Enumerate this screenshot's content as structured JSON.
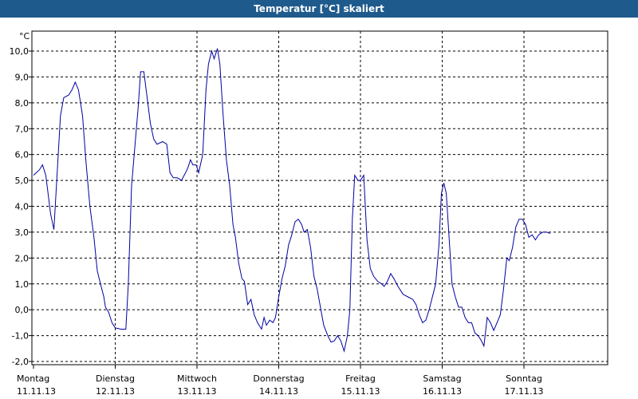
{
  "window": {
    "title": "Temperatur [°C] skaliert"
  },
  "chart_data": {
    "type": "line",
    "title": "Temperatur [°C] skaliert",
    "ylabel": "°C",
    "ylim": [
      -2.0,
      10.0
    ],
    "y_ticks": [
      "10,0",
      "9,0",
      "8,0",
      "7,0",
      "6,0",
      "5,0",
      "4,0",
      "3,0",
      "2,0",
      "1,0",
      "0,0",
      "-1,0",
      "-2,0"
    ],
    "x_range": [
      0,
      7.2
    ],
    "x_ticks": [
      {
        "day": "Montag",
        "date": "11.11.13",
        "x": 0
      },
      {
        "day": "Dienstag",
        "date": "12.11.13",
        "x": 1
      },
      {
        "day": "Mittwoch",
        "date": "13.11.13",
        "x": 2
      },
      {
        "day": "Donnerstag",
        "date": "14.11.13",
        "x": 3
      },
      {
        "day": "Freitag",
        "date": "15.11.13",
        "x": 4
      },
      {
        "day": "Samstag",
        "date": "16.11.13",
        "x": 5
      },
      {
        "day": "Sonntag",
        "date": "17.11.13",
        "x": 6
      }
    ],
    "grid": true,
    "line_color": "#0000a0",
    "series": [
      {
        "values": [
          [
            0.0,
            5.2
          ],
          [
            0.07,
            5.4
          ],
          [
            0.11,
            5.6
          ],
          [
            0.15,
            5.2
          ],
          [
            0.21,
            3.7
          ],
          [
            0.25,
            3.1
          ],
          [
            0.29,
            5.3
          ],
          [
            0.33,
            7.5
          ],
          [
            0.37,
            8.2
          ],
          [
            0.43,
            8.3
          ],
          [
            0.47,
            8.5
          ],
          [
            0.51,
            8.8
          ],
          [
            0.55,
            8.5
          ],
          [
            0.6,
            7.5
          ],
          [
            0.64,
            5.8
          ],
          [
            0.69,
            4.0
          ],
          [
            0.74,
            2.8
          ],
          [
            0.78,
            1.5
          ],
          [
            0.82,
            1.0
          ],
          [
            0.86,
            0.5
          ],
          [
            0.88,
            0.1
          ],
          [
            0.92,
            -0.1
          ],
          [
            0.96,
            -0.5
          ],
          [
            1.0,
            -0.7
          ],
          [
            1.07,
            -0.75
          ],
          [
            1.13,
            -0.75
          ],
          [
            1.16,
            1.0
          ],
          [
            1.2,
            4.8
          ],
          [
            1.24,
            6.3
          ],
          [
            1.28,
            7.8
          ],
          [
            1.31,
            9.2
          ],
          [
            1.35,
            9.2
          ],
          [
            1.39,
            8.2
          ],
          [
            1.43,
            7.2
          ],
          [
            1.47,
            6.6
          ],
          [
            1.51,
            6.4
          ],
          [
            1.58,
            6.5
          ],
          [
            1.63,
            6.4
          ],
          [
            1.67,
            5.3
          ],
          [
            1.71,
            5.1
          ],
          [
            1.76,
            5.1
          ],
          [
            1.81,
            5.0
          ],
          [
            1.86,
            5.3
          ],
          [
            1.89,
            5.5
          ],
          [
            1.92,
            5.8
          ],
          [
            1.95,
            5.6
          ],
          [
            1.99,
            5.6
          ],
          [
            2.02,
            5.3
          ],
          [
            2.07,
            6.0
          ],
          [
            2.11,
            8.5
          ],
          [
            2.14,
            9.5
          ],
          [
            2.18,
            10.0
          ],
          [
            2.21,
            9.7
          ],
          [
            2.25,
            10.1
          ],
          [
            2.28,
            9.5
          ],
          [
            2.32,
            7.5
          ],
          [
            2.36,
            5.8
          ],
          [
            2.4,
            4.8
          ],
          [
            2.44,
            3.3
          ],
          [
            2.47,
            2.8
          ],
          [
            2.51,
            1.8
          ],
          [
            2.55,
            1.2
          ],
          [
            2.58,
            1.1
          ],
          [
            2.62,
            0.2
          ],
          [
            2.66,
            0.4
          ],
          [
            2.7,
            -0.2
          ],
          [
            2.74,
            -0.5
          ],
          [
            2.79,
            -0.75
          ],
          [
            2.82,
            -0.3
          ],
          [
            2.85,
            -0.6
          ],
          [
            2.89,
            -0.4
          ],
          [
            2.93,
            -0.5
          ],
          [
            2.96,
            -0.3
          ],
          [
            3.0,
            0.5
          ],
          [
            3.04,
            1.2
          ],
          [
            3.08,
            1.7
          ],
          [
            3.12,
            2.5
          ],
          [
            3.16,
            2.9
          ],
          [
            3.2,
            3.4
          ],
          [
            3.24,
            3.5
          ],
          [
            3.28,
            3.3
          ],
          [
            3.31,
            3.0
          ],
          [
            3.35,
            3.1
          ],
          [
            3.39,
            2.4
          ],
          [
            3.43,
            1.3
          ],
          [
            3.47,
            0.8
          ],
          [
            3.51,
            0.1
          ],
          [
            3.55,
            -0.6
          ],
          [
            3.6,
            -1.0
          ],
          [
            3.64,
            -1.25
          ],
          [
            3.68,
            -1.2
          ],
          [
            3.72,
            -1.0
          ],
          [
            3.76,
            -1.2
          ],
          [
            3.8,
            -1.6
          ],
          [
            3.84,
            -1.0
          ],
          [
            3.87,
            0.0
          ],
          [
            3.9,
            3.5
          ],
          [
            3.93,
            5.2
          ],
          [
            3.97,
            5.0
          ],
          [
            4.0,
            5.0
          ],
          [
            4.04,
            5.2
          ],
          [
            4.08,
            2.7
          ],
          [
            4.12,
            1.6
          ],
          [
            4.16,
            1.3
          ],
          [
            4.21,
            1.1
          ],
          [
            4.26,
            1.0
          ],
          [
            4.29,
            0.9
          ],
          [
            4.33,
            1.1
          ],
          [
            4.37,
            1.4
          ],
          [
            4.41,
            1.2
          ],
          [
            4.46,
            0.9
          ],
          [
            4.52,
            0.6
          ],
          [
            4.58,
            0.5
          ],
          [
            4.64,
            0.4
          ],
          [
            4.68,
            0.2
          ],
          [
            4.72,
            -0.2
          ],
          [
            4.76,
            -0.5
          ],
          [
            4.8,
            -0.4
          ],
          [
            4.84,
            0.0
          ],
          [
            4.88,
            0.5
          ],
          [
            4.92,
            1.0
          ],
          [
            4.96,
            2.5
          ],
          [
            4.99,
            4.5
          ],
          [
            5.02,
            4.9
          ],
          [
            5.05,
            4.5
          ],
          [
            5.08,
            3.0
          ],
          [
            5.12,
            1.0
          ],
          [
            5.16,
            0.5
          ],
          [
            5.2,
            0.1
          ],
          [
            5.24,
            0.1
          ],
          [
            5.28,
            -0.3
          ],
          [
            5.32,
            -0.5
          ],
          [
            5.36,
            -0.5
          ],
          [
            5.4,
            -0.9
          ],
          [
            5.44,
            -1.0
          ],
          [
            5.48,
            -1.2
          ],
          [
            5.51,
            -1.4
          ],
          [
            5.55,
            -0.3
          ],
          [
            5.59,
            -0.5
          ],
          [
            5.63,
            -0.8
          ],
          [
            5.67,
            -0.5
          ],
          [
            5.71,
            -0.2
          ],
          [
            5.75,
            0.8
          ],
          [
            5.79,
            2.0
          ],
          [
            5.82,
            1.9
          ],
          [
            5.86,
            2.4
          ],
          [
            5.9,
            3.2
          ],
          [
            5.94,
            3.5
          ],
          [
            5.98,
            3.5
          ],
          [
            6.02,
            3.3
          ],
          [
            6.06,
            2.8
          ],
          [
            6.1,
            2.9
          ],
          [
            6.14,
            2.7
          ],
          [
            6.18,
            2.9
          ],
          [
            6.23,
            3.0
          ],
          [
            6.28,
            3.0
          ],
          [
            6.32,
            2.95
          ]
        ]
      }
    ]
  }
}
